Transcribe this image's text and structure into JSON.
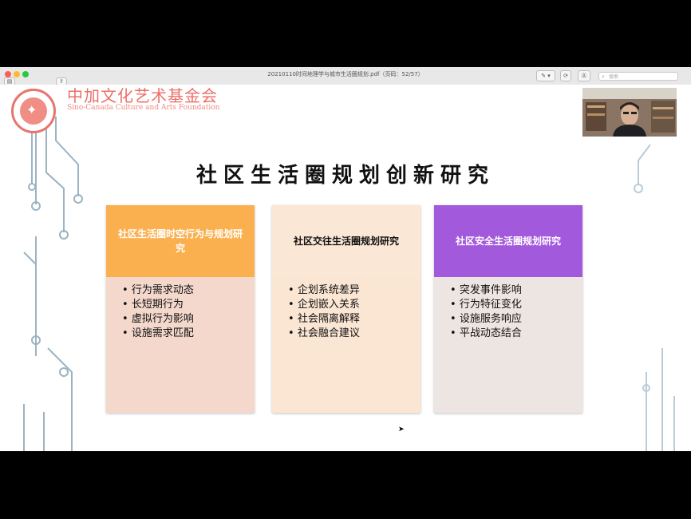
{
  "window": {
    "doc_title": "20210110时间地理学与城市生活圈规划.pdf（页码：52/57）",
    "search_placeholder": "搜索"
  },
  "slide": {
    "logo_cn": "中加文化艺术基金会",
    "logo_en": "Sino-Canada Culture and Arts Foundation",
    "title": "社区生活圈规划创新研究",
    "cards": [
      {
        "heading": "社区生活圈时空行为与规划研究",
        "head_color": "#fbb04f",
        "head_text_color": "#ffffff",
        "body_color": "#f4d8cc",
        "items": [
          "行为需求动态",
          "长短期行为",
          "虚拟行为影响",
          "设施需求匹配"
        ]
      },
      {
        "heading": "社区交往生活圈规划研究",
        "head_color": "#fbe7d6",
        "head_text_color": "#111111",
        "body_color": "#fbe6d4",
        "items": [
          "企划系统差异",
          "企划嵌入关系",
          "社会隔离解释",
          "社会融合建议"
        ]
      },
      {
        "heading": "社区安全生活圈规划研究",
        "head_color": "#a359db",
        "head_text_color": "#ffffff",
        "body_color": "#ede5e1",
        "items": [
          "突发事件影响",
          "行为特征变化",
          "设施服务响应",
          "平战动态结合"
        ]
      }
    ]
  }
}
